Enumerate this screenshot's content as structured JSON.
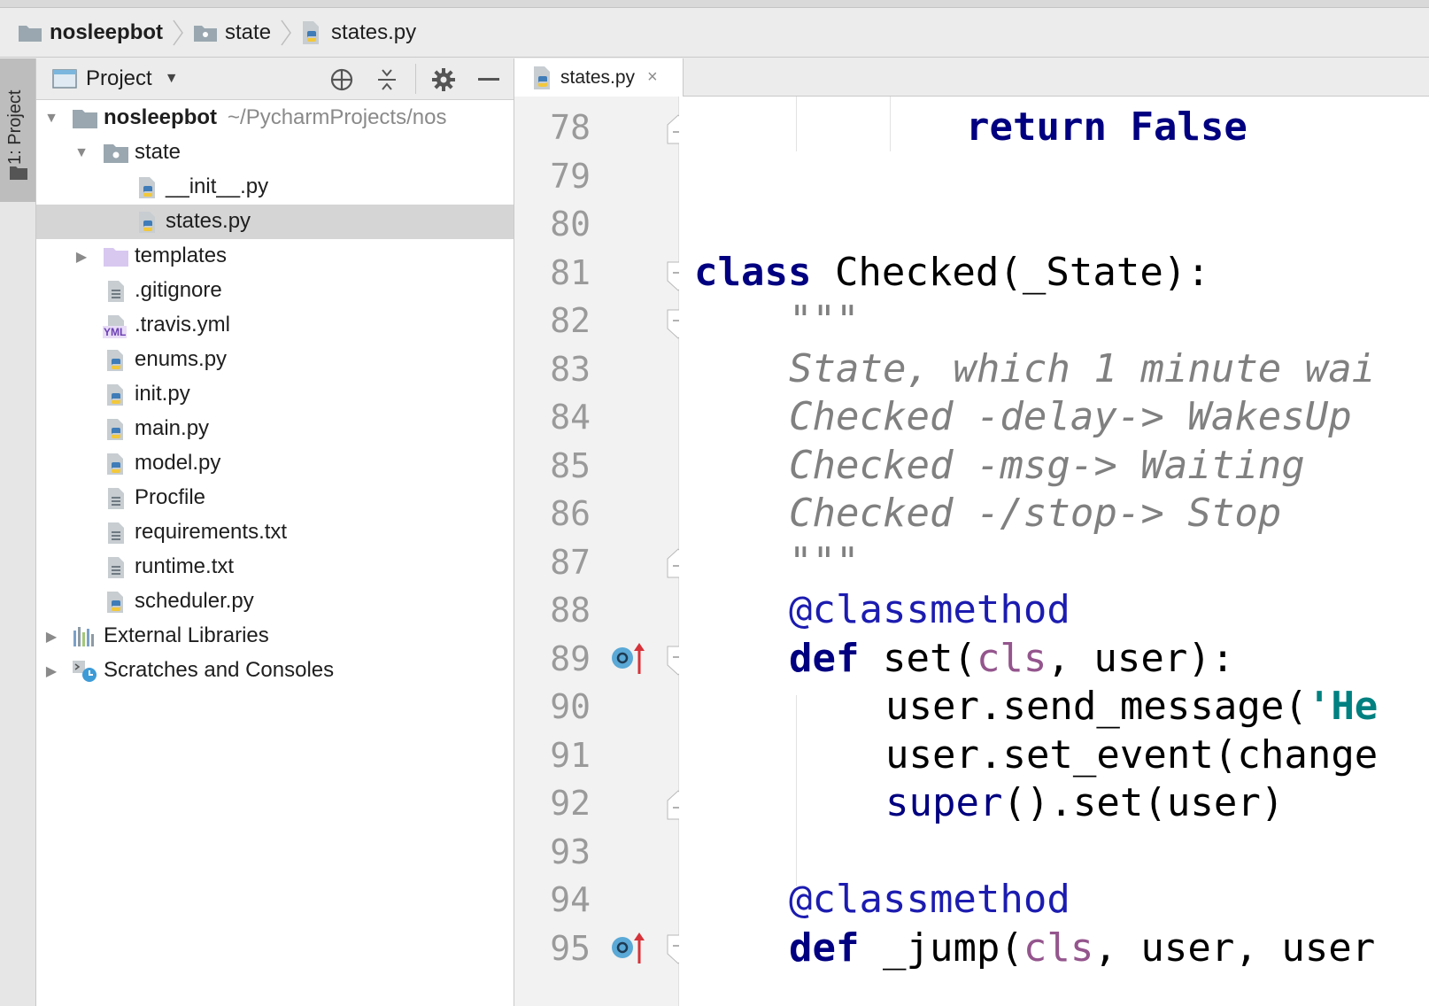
{
  "breadcrumb": {
    "items": [
      {
        "label": "nosleepbot",
        "icon": "folder-icon"
      },
      {
        "label": "state",
        "icon": "package-folder-icon"
      },
      {
        "label": "states.py",
        "icon": "python-file-icon"
      }
    ]
  },
  "tool_stripe": {
    "project_button_label": "1: Project"
  },
  "project_panel": {
    "title": "Project",
    "tools": [
      "locate-icon",
      "collapse-all-icon",
      "gear-icon",
      "hide-icon"
    ],
    "root": {
      "name": "nosleepbot",
      "path": "~/PycharmProjects/nos"
    },
    "tree": [
      {
        "label": "state",
        "type": "package"
      },
      {
        "label": "__init__.py",
        "type": "python"
      },
      {
        "label": "states.py",
        "type": "python",
        "selected": true
      },
      {
        "label": "templates",
        "type": "folder"
      },
      {
        "label": ".gitignore",
        "type": "text"
      },
      {
        "label": ".travis.yml",
        "type": "yaml"
      },
      {
        "label": "enums.py",
        "type": "python"
      },
      {
        "label": "init.py",
        "type": "python"
      },
      {
        "label": "main.py",
        "type": "python"
      },
      {
        "label": "model.py",
        "type": "python"
      },
      {
        "label": "Procfile",
        "type": "text"
      },
      {
        "label": "requirements.txt",
        "type": "text"
      },
      {
        "label": "runtime.txt",
        "type": "text"
      },
      {
        "label": "scheduler.py",
        "type": "python"
      },
      {
        "label": "External Libraries",
        "type": "libraries"
      },
      {
        "label": "Scratches and Consoles",
        "type": "scratches"
      }
    ],
    "yaml_badge": "YML"
  },
  "editor": {
    "tab_label": "states.py",
    "tab_close": "×",
    "line_numbers": [
      "78",
      "79",
      "80",
      "81",
      "82",
      "83",
      "84",
      "85",
      "86",
      "87",
      "88",
      "89",
      "90",
      "91",
      "92",
      "93",
      "94",
      "95"
    ],
    "code": {
      "l78_return": "return",
      "l78_false": "False",
      "l81_class": "class",
      "l81_rest": " Checked(_State):",
      "l82_doc": "\"\"\"",
      "l83_doc": "State, which 1 minute wai",
      "l84_doc": "Checked -delay-> WakesUp",
      "l85_doc": "Checked -msg-> Waiting",
      "l86_doc": "Checked -/stop-> Stop",
      "l87_doc": "\"\"\"",
      "l88_deco": "@classmethod",
      "l89_def": "def",
      "l89_a": " set(",
      "l89_cls": "cls",
      "l89_b": ", user):",
      "l90_a": "user.send_message(",
      "l90_str": "'He",
      "l91_a": "user.set_event(change",
      "l92_super": "super",
      "l92_rest": "().set(user)",
      "l94_deco": "@classmethod",
      "l95_def": "def",
      "l95_a": " _jump(",
      "l95_cls": "cls",
      "l95_b": ", user, user"
    }
  },
  "colors": {
    "keyword": "#000080",
    "docstring": "#808080",
    "decorator": "#1c1cb0",
    "self_param": "#94558d",
    "string": "#008080",
    "selection": "#d5d5d5"
  }
}
